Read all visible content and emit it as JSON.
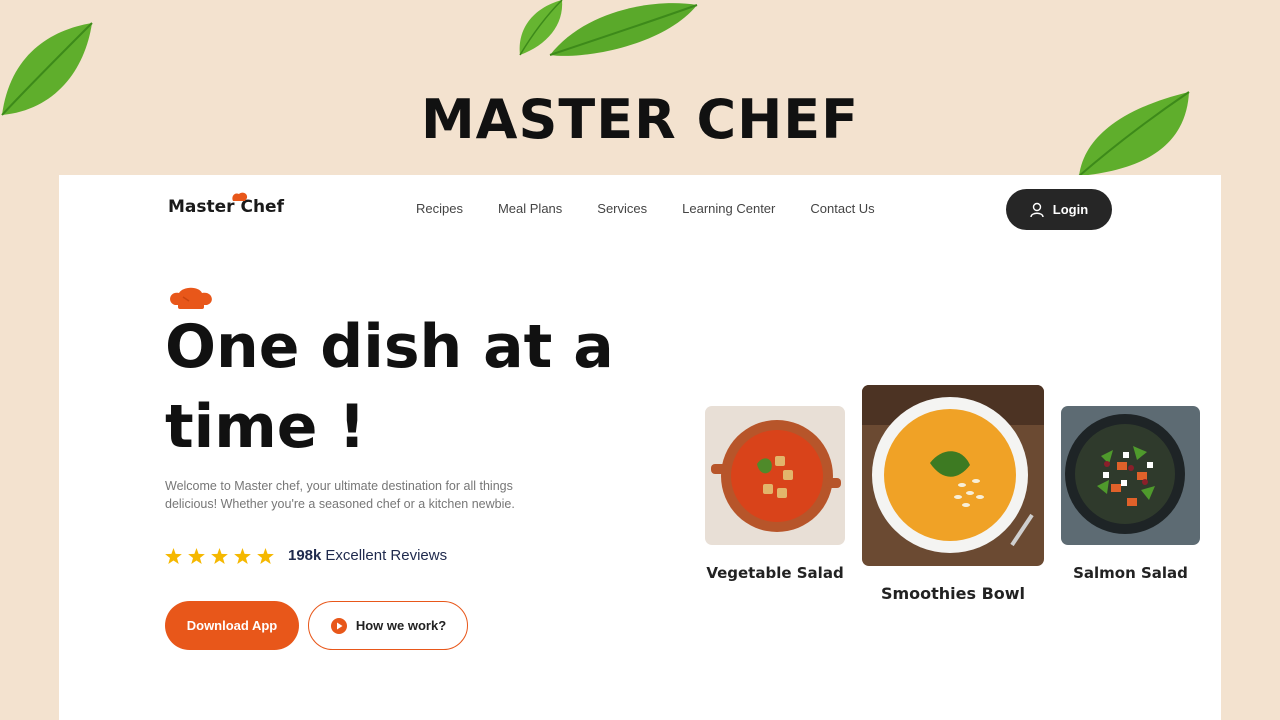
{
  "banner": {
    "title": "MASTER CHEF"
  },
  "header": {
    "logo_text": "Master Chef",
    "nav": [
      "Recipes",
      "Meal Plans",
      "Services",
      "Learning Center",
      "Contact Us"
    ],
    "login_label": "Login"
  },
  "hero": {
    "headline_line1": "One dish at a",
    "headline_line2": "time !",
    "description": "Welcome to Master chef, your ultimate destination for all things delicious! Whether you're a seasoned chef or a kitchen newbie.",
    "rating": {
      "stars": 5,
      "count": "198k",
      "label": "Excellent Reviews"
    },
    "primary_button": "Download App",
    "secondary_button": "How we work?"
  },
  "dishes": [
    {
      "name": "Vegetable Salad"
    },
    {
      "name": "Smoothies Bowl"
    },
    {
      "name": "Salmon Salad"
    }
  ],
  "colors": {
    "accent": "#e8571a",
    "dark": "#262626",
    "background": "#f3e2cf",
    "star": "#f5b800"
  }
}
